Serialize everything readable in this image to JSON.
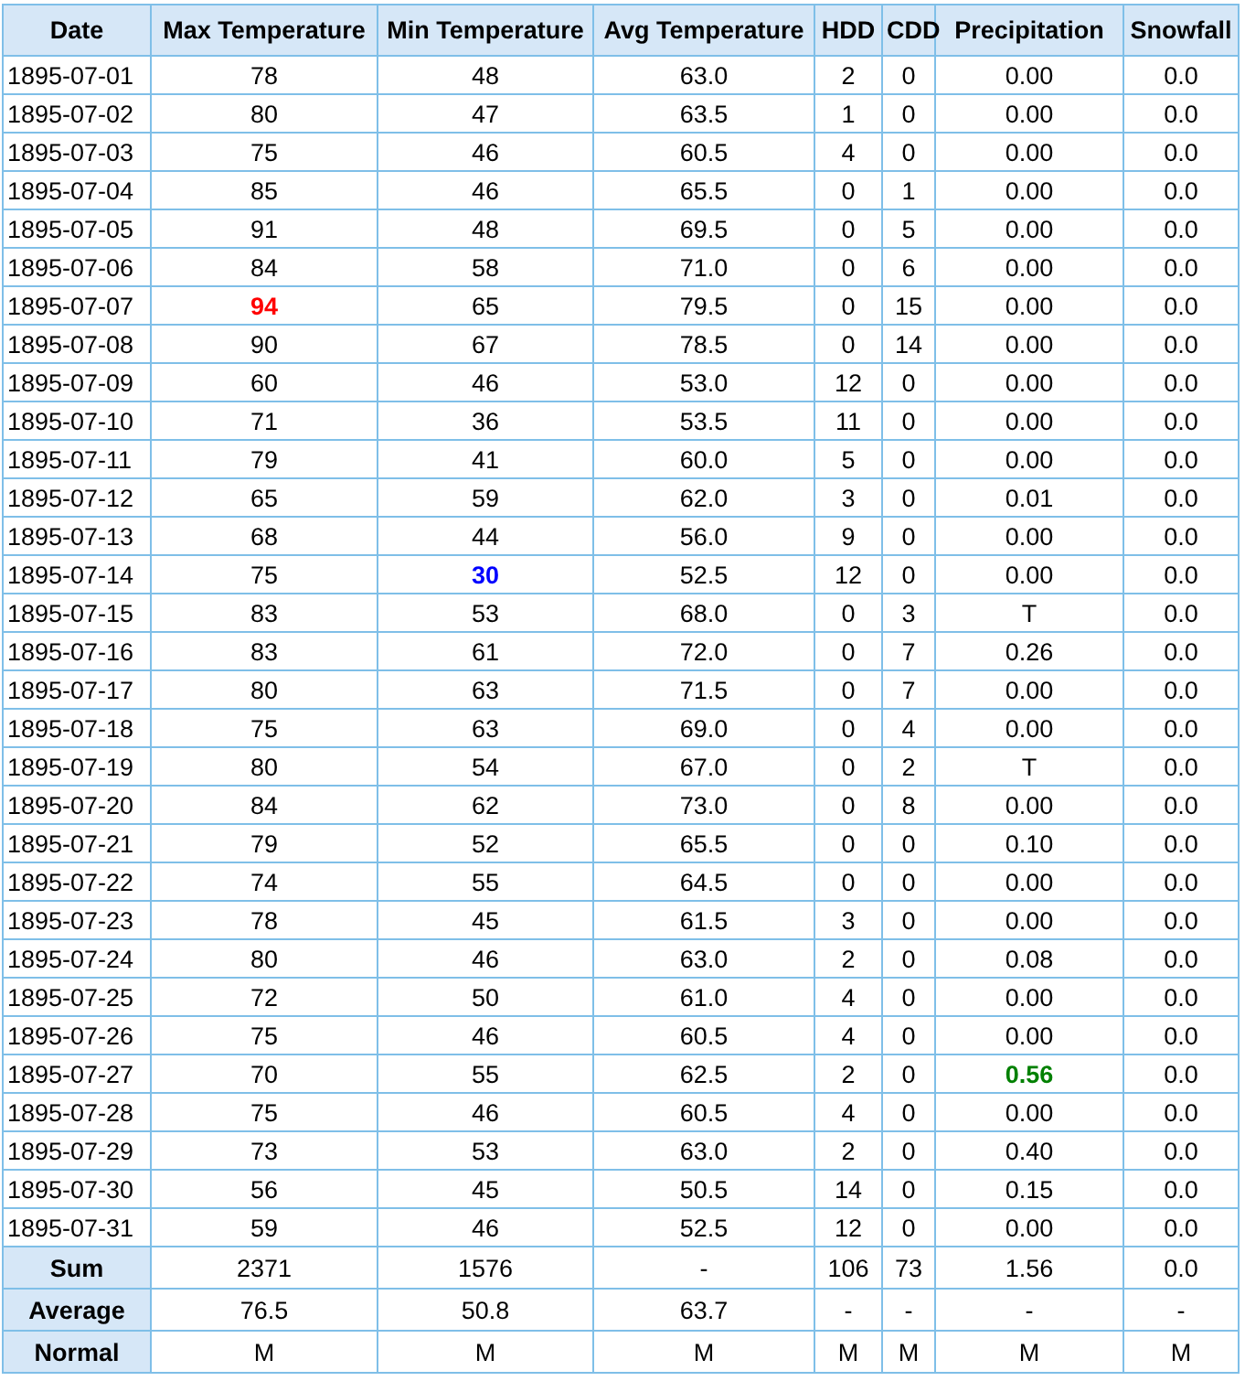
{
  "table": {
    "columns": [
      "Date",
      "Max Temperature",
      "Min Temperature",
      "Avg Temperature",
      "HDD",
      "CDD",
      "Precipitation",
      "Snowfall"
    ],
    "rows": [
      [
        "1895-07-01",
        "78",
        "48",
        "63.0",
        "2",
        "0",
        "0.00",
        "0.0"
      ],
      [
        "1895-07-02",
        "80",
        "47",
        "63.5",
        "1",
        "0",
        "0.00",
        "0.0"
      ],
      [
        "1895-07-03",
        "75",
        "46",
        "60.5",
        "4",
        "0",
        "0.00",
        "0.0"
      ],
      [
        "1895-07-04",
        "85",
        "46",
        "65.5",
        "0",
        "1",
        "0.00",
        "0.0"
      ],
      [
        "1895-07-05",
        "91",
        "48",
        "69.5",
        "0",
        "5",
        "0.00",
        "0.0"
      ],
      [
        "1895-07-06",
        "84",
        "58",
        "71.0",
        "0",
        "6",
        "0.00",
        "0.0"
      ],
      [
        "1895-07-07",
        {
          "text": "94",
          "color": "#ff0000"
        },
        "65",
        "79.5",
        "0",
        "15",
        "0.00",
        "0.0"
      ],
      [
        "1895-07-08",
        "90",
        "67",
        "78.5",
        "0",
        "14",
        "0.00",
        "0.0"
      ],
      [
        "1895-07-09",
        "60",
        "46",
        "53.0",
        "12",
        "0",
        "0.00",
        "0.0"
      ],
      [
        "1895-07-10",
        "71",
        "36",
        "53.5",
        "11",
        "0",
        "0.00",
        "0.0"
      ],
      [
        "1895-07-11",
        "79",
        "41",
        "60.0",
        "5",
        "0",
        "0.00",
        "0.0"
      ],
      [
        "1895-07-12",
        "65",
        "59",
        "62.0",
        "3",
        "0",
        "0.01",
        "0.0"
      ],
      [
        "1895-07-13",
        "68",
        "44",
        "56.0",
        "9",
        "0",
        "0.00",
        "0.0"
      ],
      [
        "1895-07-14",
        "75",
        {
          "text": "30",
          "color": "#0000ff"
        },
        "52.5",
        "12",
        "0",
        "0.00",
        "0.0"
      ],
      [
        "1895-07-15",
        "83",
        "53",
        "68.0",
        "0",
        "3",
        "T",
        "0.0"
      ],
      [
        "1895-07-16",
        "83",
        "61",
        "72.0",
        "0",
        "7",
        "0.26",
        "0.0"
      ],
      [
        "1895-07-17",
        "80",
        "63",
        "71.5",
        "0",
        "7",
        "0.00",
        "0.0"
      ],
      [
        "1895-07-18",
        "75",
        "63",
        "69.0",
        "0",
        "4",
        "0.00",
        "0.0"
      ],
      [
        "1895-07-19",
        "80",
        "54",
        "67.0",
        "0",
        "2",
        "T",
        "0.0"
      ],
      [
        "1895-07-20",
        "84",
        "62",
        "73.0",
        "0",
        "8",
        "0.00",
        "0.0"
      ],
      [
        "1895-07-21",
        "79",
        "52",
        "65.5",
        "0",
        "0",
        "0.10",
        "0.0"
      ],
      [
        "1895-07-22",
        "74",
        "55",
        "64.5",
        "0",
        "0",
        "0.00",
        "0.0"
      ],
      [
        "1895-07-23",
        "78",
        "45",
        "61.5",
        "3",
        "0",
        "0.00",
        "0.0"
      ],
      [
        "1895-07-24",
        "80",
        "46",
        "63.0",
        "2",
        "0",
        "0.08",
        "0.0"
      ],
      [
        "1895-07-25",
        "72",
        "50",
        "61.0",
        "4",
        "0",
        "0.00",
        "0.0"
      ],
      [
        "1895-07-26",
        "75",
        "46",
        "60.5",
        "4",
        "0",
        "0.00",
        "0.0"
      ],
      [
        "1895-07-27",
        "70",
        "55",
        "62.5",
        "2",
        "0",
        {
          "text": "0.56",
          "color": "#008000"
        },
        "0.0"
      ],
      [
        "1895-07-28",
        "75",
        "46",
        "60.5",
        "4",
        "0",
        "0.00",
        "0.0"
      ],
      [
        "1895-07-29",
        "73",
        "53",
        "63.0",
        "2",
        "0",
        "0.40",
        "0.0"
      ],
      [
        "1895-07-30",
        "56",
        "45",
        "50.5",
        "14",
        "0",
        "0.15",
        "0.0"
      ],
      [
        "1895-07-31",
        "59",
        "46",
        "52.5",
        "12",
        "0",
        "0.00",
        "0.0"
      ]
    ],
    "summary": [
      [
        "Sum",
        "2371",
        "1576",
        "-",
        "106",
        "73",
        "1.56",
        "0.0"
      ],
      [
        "Average",
        "76.5",
        "50.8",
        "63.7",
        "-",
        "-",
        "-",
        "-"
      ],
      [
        "Normal",
        "M",
        "M",
        "M",
        "M",
        "M",
        "M",
        "M"
      ]
    ]
  }
}
